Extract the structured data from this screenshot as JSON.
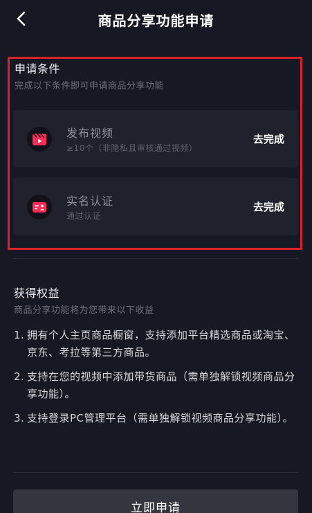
{
  "header": {
    "title": "商品分享功能申请",
    "back_icon": "chevron-left-icon"
  },
  "conditions": {
    "title": "申请条件",
    "subtitle": "完成以下条件即可申请商品分享功能",
    "items": [
      {
        "name": "发布视频",
        "desc": "≥10个（非隐私且审核通过视频）",
        "action": "去完成",
        "icon": "video-clapper-icon"
      },
      {
        "name": "实名认证",
        "desc": "通过认证",
        "action": "去完成",
        "icon": "id-card-icon"
      }
    ]
  },
  "benefits": {
    "title": "获得权益",
    "subtitle": "商品分享功能将为您带来以下收益",
    "items": [
      {
        "num": "1.",
        "text": "拥有个人主页商品橱窗，支持添加平台精选商品或淘宝、京东、考拉等第三方商品。"
      },
      {
        "num": "2.",
        "text": "支持在您的视频中添加带货商品（需单独解锁视频商品分享功能）。"
      },
      {
        "num": "3.",
        "text": "支持登录PC管理平台（需单独解锁视频商品分享功能）。"
      }
    ]
  },
  "footer": {
    "apply_label": "立即申请"
  },
  "colors": {
    "background": "#161823",
    "card": "#1f212d",
    "icon_accent": "#fe2c55",
    "highlight_frame": "#d9222a",
    "button": "#33353f"
  }
}
